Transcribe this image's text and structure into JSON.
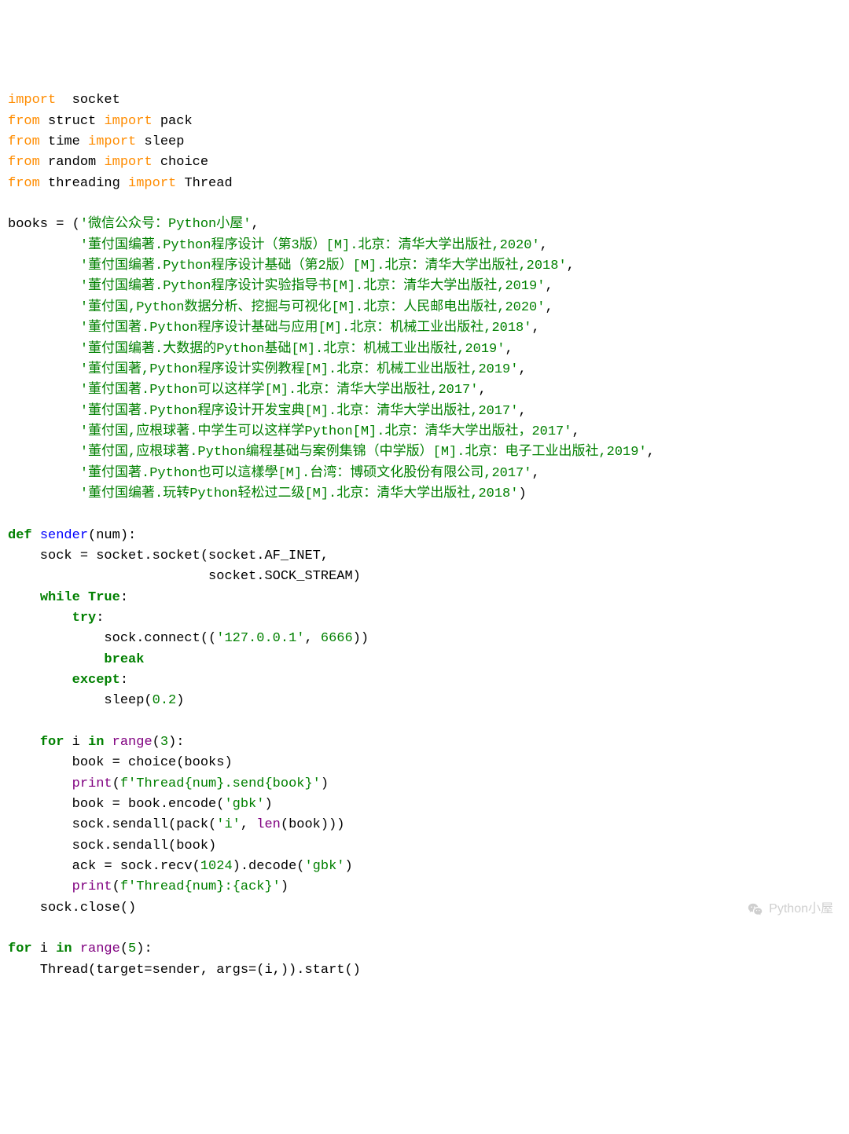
{
  "code_lines": [
    [
      [
        "kw2",
        "import"
      ],
      [
        "",
        "  socket"
      ]
    ],
    [
      [
        "kw2",
        "from"
      ],
      [
        "",
        " struct "
      ],
      [
        "kw2",
        "import"
      ],
      [
        "",
        " pack"
      ]
    ],
    [
      [
        "kw2",
        "from"
      ],
      [
        "",
        " time "
      ],
      [
        "kw2",
        "import"
      ],
      [
        "",
        " sleep"
      ]
    ],
    [
      [
        "kw2",
        "from"
      ],
      [
        "",
        " random "
      ],
      [
        "kw2",
        "import"
      ],
      [
        "",
        " choice"
      ]
    ],
    [
      [
        "kw2",
        "from"
      ],
      [
        "",
        " threading "
      ],
      [
        "kw2",
        "import"
      ],
      [
        "",
        " Thread"
      ]
    ],
    [
      [
        "",
        ""
      ]
    ],
    [
      [
        "",
        "books = ("
      ],
      [
        "str",
        "'微信公众号：Python小屋'"
      ],
      [
        "",
        ","
      ]
    ],
    [
      [
        "",
        "         "
      ],
      [
        "str",
        "'董付国编著.Python程序设计（第3版）[M].北京：清华大学出版社,2020'"
      ],
      [
        "",
        ","
      ]
    ],
    [
      [
        "",
        "         "
      ],
      [
        "str",
        "'董付国编著.Python程序设计基础（第2版）[M].北京：清华大学出版社,2018'"
      ],
      [
        "",
        ","
      ]
    ],
    [
      [
        "",
        "         "
      ],
      [
        "str",
        "'董付国编著.Python程序设计实验指导书[M].北京：清华大学出版社,2019'"
      ],
      [
        "",
        ","
      ]
    ],
    [
      [
        "",
        "         "
      ],
      [
        "str",
        "'董付国,Python数据分析、挖掘与可视化[M].北京：人民邮电出版社,2020'"
      ],
      [
        "",
        ","
      ]
    ],
    [
      [
        "",
        "         "
      ],
      [
        "str",
        "'董付国著.Python程序设计基础与应用[M].北京：机械工业出版社,2018'"
      ],
      [
        "",
        ","
      ]
    ],
    [
      [
        "",
        "         "
      ],
      [
        "str",
        "'董付国编著.大数据的Python基础[M].北京：机械工业出版社,2019'"
      ],
      [
        "",
        ","
      ]
    ],
    [
      [
        "",
        "         "
      ],
      [
        "str",
        "'董付国著,Python程序设计实例教程[M].北京：机械工业出版社,2019'"
      ],
      [
        "",
        ","
      ]
    ],
    [
      [
        "",
        "         "
      ],
      [
        "str",
        "'董付国著.Python可以这样学[M].北京：清华大学出版社,2017'"
      ],
      [
        "",
        ","
      ]
    ],
    [
      [
        "",
        "         "
      ],
      [
        "str",
        "'董付国著.Python程序设计开发宝典[M].北京：清华大学出版社,2017'"
      ],
      [
        "",
        ","
      ]
    ],
    [
      [
        "",
        "         "
      ],
      [
        "str",
        "'董付国,应根球著.中学生可以这样学Python[M].北京：清华大学出版社，2017'"
      ],
      [
        "",
        ","
      ]
    ],
    [
      [
        "",
        "         "
      ],
      [
        "str",
        "'董付国,应根球著.Python编程基础与案例集锦（中学版）[M].北京：电子工业出版社,2019'"
      ],
      [
        "",
        ","
      ]
    ],
    [
      [
        "",
        "         "
      ],
      [
        "str",
        "'董付国著.Python也可以這樣學[M].台湾：博硕文化股份有限公司,2017'"
      ],
      [
        "",
        ","
      ]
    ],
    [
      [
        "",
        "         "
      ],
      [
        "str",
        "'董付国编著.玩转Python轻松过二级[M].北京：清华大学出版社,2018'"
      ],
      [
        "",
        ")"
      ]
    ],
    [
      [
        "",
        ""
      ]
    ],
    [
      [
        "kw",
        "def"
      ],
      [
        "",
        " "
      ],
      [
        "fn",
        "sender"
      ],
      [
        "",
        "(num):"
      ]
    ],
    [
      [
        "",
        "    sock = socket.socket(socket.AF_INET,"
      ]
    ],
    [
      [
        "",
        "                         socket.SOCK_STREAM)"
      ]
    ],
    [
      [
        "",
        "    "
      ],
      [
        "kw",
        "while"
      ],
      [
        "",
        " "
      ],
      [
        "kw",
        "True"
      ],
      [
        "",
        ":"
      ]
    ],
    [
      [
        "",
        "        "
      ],
      [
        "kw",
        "try"
      ],
      [
        "",
        ":"
      ]
    ],
    [
      [
        "",
        "            sock.connect(("
      ],
      [
        "str",
        "'127.0.0.1'"
      ],
      [
        "",
        ", "
      ],
      [
        "lit",
        "6666"
      ],
      [
        "",
        "))"
      ]
    ],
    [
      [
        "",
        "            "
      ],
      [
        "kw",
        "break"
      ]
    ],
    [
      [
        "",
        "        "
      ],
      [
        "kw",
        "except"
      ],
      [
        "",
        ":"
      ]
    ],
    [
      [
        "",
        "            sleep("
      ],
      [
        "lit",
        "0.2"
      ],
      [
        "",
        ")"
      ]
    ],
    [
      [
        "",
        ""
      ]
    ],
    [
      [
        "",
        "    "
      ],
      [
        "kw",
        "for"
      ],
      [
        "",
        " i "
      ],
      [
        "kw",
        "in"
      ],
      [
        "",
        " "
      ],
      [
        "pr",
        "range"
      ],
      [
        "",
        "("
      ],
      [
        "lit",
        "3"
      ],
      [
        "",
        "):"
      ]
    ],
    [
      [
        "",
        "        book = choice(books)"
      ]
    ],
    [
      [
        "",
        "        "
      ],
      [
        "pr",
        "print"
      ],
      [
        "",
        "("
      ],
      [
        "str",
        "f'Thread{num}.send{book}'"
      ],
      [
        "",
        ")"
      ]
    ],
    [
      [
        "",
        "        book = book.encode("
      ],
      [
        "str",
        "'gbk'"
      ],
      [
        "",
        ")"
      ]
    ],
    [
      [
        "",
        "        sock.sendall(pack("
      ],
      [
        "str",
        "'i'"
      ],
      [
        "",
        ", "
      ],
      [
        "pr",
        "len"
      ],
      [
        "",
        "(book)))"
      ]
    ],
    [
      [
        "",
        "        sock.sendall(book)"
      ]
    ],
    [
      [
        "",
        "        ack = sock.recv("
      ],
      [
        "lit",
        "1024"
      ],
      [
        "",
        ").decode("
      ],
      [
        "str",
        "'gbk'"
      ],
      [
        "",
        ")"
      ]
    ],
    [
      [
        "",
        "        "
      ],
      [
        "pr",
        "print"
      ],
      [
        "",
        "("
      ],
      [
        "str",
        "f'Thread{num}:{ack}'"
      ],
      [
        "",
        ")"
      ]
    ],
    [
      [
        "",
        "    sock.close()"
      ]
    ],
    [
      [
        "",
        ""
      ]
    ],
    [
      [
        "kw",
        "for"
      ],
      [
        "",
        " i "
      ],
      [
        "kw",
        "in"
      ],
      [
        "",
        " "
      ],
      [
        "pr",
        "range"
      ],
      [
        "",
        "("
      ],
      [
        "lit",
        "5"
      ],
      [
        "",
        "):"
      ]
    ],
    [
      [
        "",
        "    Thread(target=sender, args=(i,)).start()"
      ]
    ]
  ],
  "watermark": "Python小屋"
}
